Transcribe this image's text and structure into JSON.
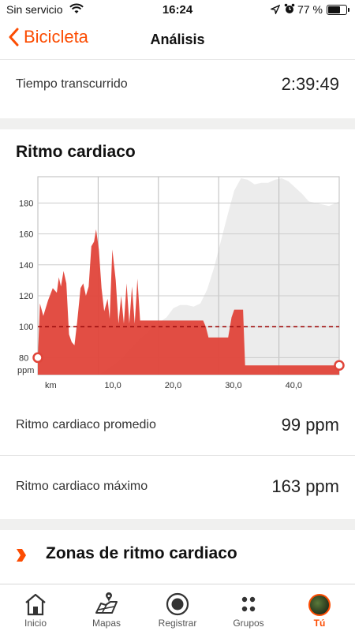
{
  "status_bar": {
    "carrier": "Sin servicio",
    "time": "16:24",
    "battery": "77 %",
    "battery_level": 0.77
  },
  "nav": {
    "back_label": "Bicicleta",
    "title": "Análisis"
  },
  "elapsed": {
    "label": "Tiempo transcurrido",
    "value": "2:39:49"
  },
  "heart_rate_section": {
    "title": "Ritmo cardiaco"
  },
  "chart_data": {
    "type": "area",
    "title": "Ritmo cardiaco",
    "ylabel": "ppm",
    "xlabel": "km",
    "x_ticks": [
      "10,0",
      "20,0",
      "30,0",
      "40,0"
    ],
    "y_ticks": [
      "80",
      "100",
      "120",
      "140",
      "160",
      "180"
    ],
    "xlim": [
      0,
      44.5
    ],
    "ylim": [
      69,
      197
    ],
    "average_line": 100,
    "colors": {
      "heart": "#e0453a",
      "elevation": "#ececec",
      "average": "#a01010"
    },
    "series": [
      {
        "name": "Ritmo cardiaco",
        "x": [
          0,
          0.3,
          0.8,
          1.5,
          2.2,
          2.8,
          3.1,
          3.4,
          3.8,
          4.2,
          4.6,
          5.0,
          5.4,
          5.8,
          6.3,
          6.7,
          7.1,
          7.5,
          7.9,
          8.3,
          8.6,
          9.0,
          9.4,
          9.8,
          10.3,
          10.6,
          11.0,
          11.5,
          11.9,
          12.3,
          12.7,
          13.1,
          13.5,
          13.9,
          14.3,
          14.7,
          15.1,
          15.5,
          16.0,
          16.5,
          17.0,
          17.5,
          18.0,
          18.5,
          19.0,
          19.5,
          20.0,
          20.5,
          21.0,
          21.5,
          22.0,
          22.5,
          23.0,
          23.5,
          24.0,
          24.4,
          24.8,
          25.2,
          26.0,
          27.0,
          27.7,
          28.1,
          28.6,
          29.0,
          29.5,
          30.0,
          30.3,
          30.6,
          31.0,
          32.0,
          34.0,
          36.0,
          38.0,
          40.0,
          42.0,
          44.0,
          44.5
        ],
        "values": [
          80,
          115,
          107,
          117,
          125,
          122,
          132,
          126,
          136,
          128,
          95,
          90,
          88,
          103,
          125,
          128,
          120,
          126,
          152,
          155,
          163,
          150,
          125,
          110,
          118,
          105,
          150,
          130,
          102,
          120,
          102,
          128,
          102,
          126,
          102,
          131,
          104,
          104,
          104,
          104,
          104,
          104,
          104,
          104,
          104,
          104,
          104,
          104,
          104,
          104,
          104,
          104,
          104,
          104,
          104,
          104,
          100,
          93,
          93,
          93,
          93,
          93,
          106,
          111,
          111,
          111,
          111,
          75,
          75,
          75,
          75,
          75,
          75,
          75,
          75,
          75,
          75
        ]
      },
      {
        "name": "Elevación",
        "x": [
          0,
          3,
          6,
          9,
          12,
          15,
          18,
          19,
          20,
          21,
          22,
          23,
          24,
          25,
          26,
          27,
          28,
          29,
          30,
          31,
          32,
          33,
          34,
          35,
          36,
          37,
          38,
          39,
          40,
          41,
          42,
          43,
          44,
          44.5
        ],
        "values": [
          69,
          69,
          69,
          69,
          78,
          92,
          103,
          106,
          112,
          114,
          114,
          113,
          115,
          124,
          138,
          155,
          172,
          188,
          196,
          195,
          192,
          193,
          193,
          195,
          196,
          194,
          190,
          186,
          181,
          180,
          179,
          178,
          180,
          181
        ]
      }
    ]
  },
  "stats": [
    {
      "label": "Ritmo cardiaco promedio",
      "value": "99 ppm"
    },
    {
      "label": "Ritmo cardiaco máximo",
      "value": "163 ppm"
    }
  ],
  "zones": {
    "label": "Zonas de ritmo cardiaco"
  },
  "tabbar": [
    {
      "label": "Inicio",
      "icon": "home-icon"
    },
    {
      "label": "Mapas",
      "icon": "map-icon"
    },
    {
      "label": "Registrar",
      "icon": "record-icon"
    },
    {
      "label": "Grupos",
      "icon": "groups-icon"
    },
    {
      "label": "Tú",
      "icon": "avatar-icon"
    }
  ]
}
